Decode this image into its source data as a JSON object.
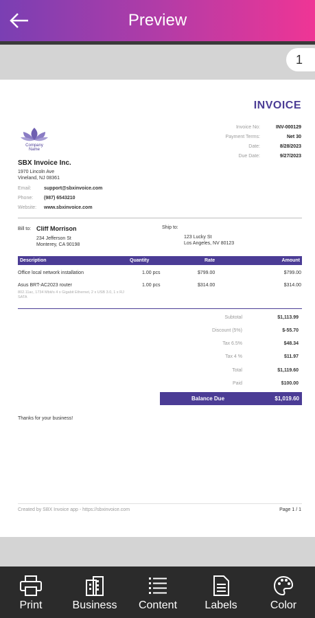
{
  "app": {
    "title": "Preview",
    "page_badge": "1"
  },
  "invoice": {
    "heading": "INVOICE",
    "logo_text": "Company\nName",
    "meta": [
      {
        "label": "Invoice No:",
        "value": "INV-000129"
      },
      {
        "label": "Payment Terms:",
        "value": "Net 30"
      },
      {
        "label": "Date:",
        "value": "8/28/2023"
      },
      {
        "label": "Due Date:",
        "value": "9/27/2023"
      }
    ],
    "company": {
      "name": "SBX Invoice Inc.",
      "address1": "1970 Lincoln Ave",
      "address2": "Vineland, NJ 08361",
      "email_label": "Email:",
      "email": "support@sbxinvoice.com",
      "phone_label": "Phone:",
      "phone": "(987) 6543210",
      "website_label": "Website:",
      "website": "www.sbxinvoice.com"
    },
    "bill_to": {
      "label": "Bill to:",
      "name": "Cliff Morrison",
      "address1": "234 Jefferson St",
      "address2": "Monterey, CA 90198"
    },
    "ship_to": {
      "label": "Ship to:",
      "address1": "123 Lucky St",
      "address2": "Los Angeles, NV 80123"
    },
    "table": {
      "headers": {
        "description": "Description",
        "quantity": "Quantity",
        "rate": "Rate",
        "amount": "Amount"
      },
      "rows": [
        {
          "description": "Office local network installation",
          "quantity": "1.00 pcs",
          "rate": "$799.00",
          "amount": "$799.00",
          "note": ""
        },
        {
          "description": "Asus BRT-AC2023 router",
          "quantity": "1.00 pcs",
          "rate": "$314.00",
          "amount": "$314.00",
          "note": "802.11ac, 1734 Mbit/s 4 x Gigabit Ethernet, 2 x USB 3.0, 1 x RJ SATA"
        }
      ]
    },
    "totals": [
      {
        "label": "Subtotal",
        "value": "$1,113.99"
      },
      {
        "label": "Discount (5%)",
        "value": "$-55.70"
      },
      {
        "label": "Tax 6.5%",
        "value": "$48.34"
      },
      {
        "label": "Tax 4 %",
        "value": "$11.97"
      },
      {
        "label": "Total",
        "value": "$1,119.60"
      },
      {
        "label": "Paid",
        "value": "$100.00"
      }
    ],
    "balance_due": {
      "label": "Balance Due",
      "value": "$1,019.60"
    },
    "thanks": "Thanks for your business!",
    "footer_left": "Created by SBX Invoice app - https://sbxinvoice.com",
    "footer_right": "Page 1 / 1"
  },
  "nav": {
    "items": [
      {
        "label": "Print",
        "icon": "printer-icon"
      },
      {
        "label": "Business",
        "icon": "building-icon"
      },
      {
        "label": "Content",
        "icon": "list-icon"
      },
      {
        "label": "Labels",
        "icon": "document-icon"
      },
      {
        "label": "Color",
        "icon": "palette-icon"
      }
    ]
  },
  "colors": {
    "accent": "#4b3c95",
    "gradient_start": "#7a3fb3",
    "gradient_end": "#ef3595"
  }
}
